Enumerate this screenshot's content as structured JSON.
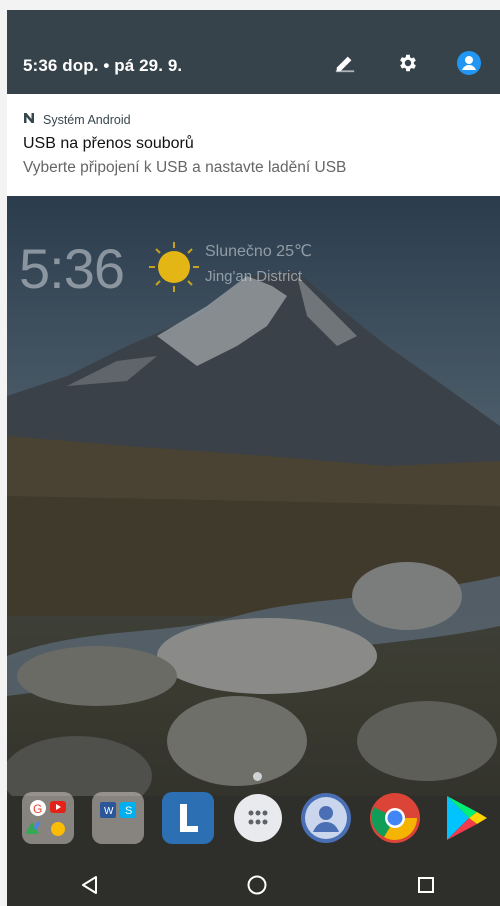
{
  "status": {
    "time_date": "5:36 dop. • pá 29. 9."
  },
  "quick_settings": {
    "icons": [
      "edit-icon",
      "settings-gear-icon",
      "user-account-icon"
    ]
  },
  "notification": {
    "app_name": "Systém Android",
    "title": "USB na přenos souborů",
    "text": "Vyberte připojení k USB a nastavte ladění USB"
  },
  "widget": {
    "time": "5:36",
    "condition": "Slunečno  25℃",
    "location": "Jing'an District"
  },
  "dock": {
    "items": [
      "google-apps-folder",
      "office-apps-folder",
      "l-app-icon",
      "app-drawer-icon",
      "contacts-icon",
      "chrome-icon",
      "play-store-icon"
    ]
  },
  "navbar": {
    "buttons": [
      "back-icon",
      "home-icon",
      "recents-icon"
    ]
  },
  "colors": {
    "header_bg": "#37434a",
    "notification_bg": "#ffffff",
    "accent_blue": "#2196f3"
  }
}
